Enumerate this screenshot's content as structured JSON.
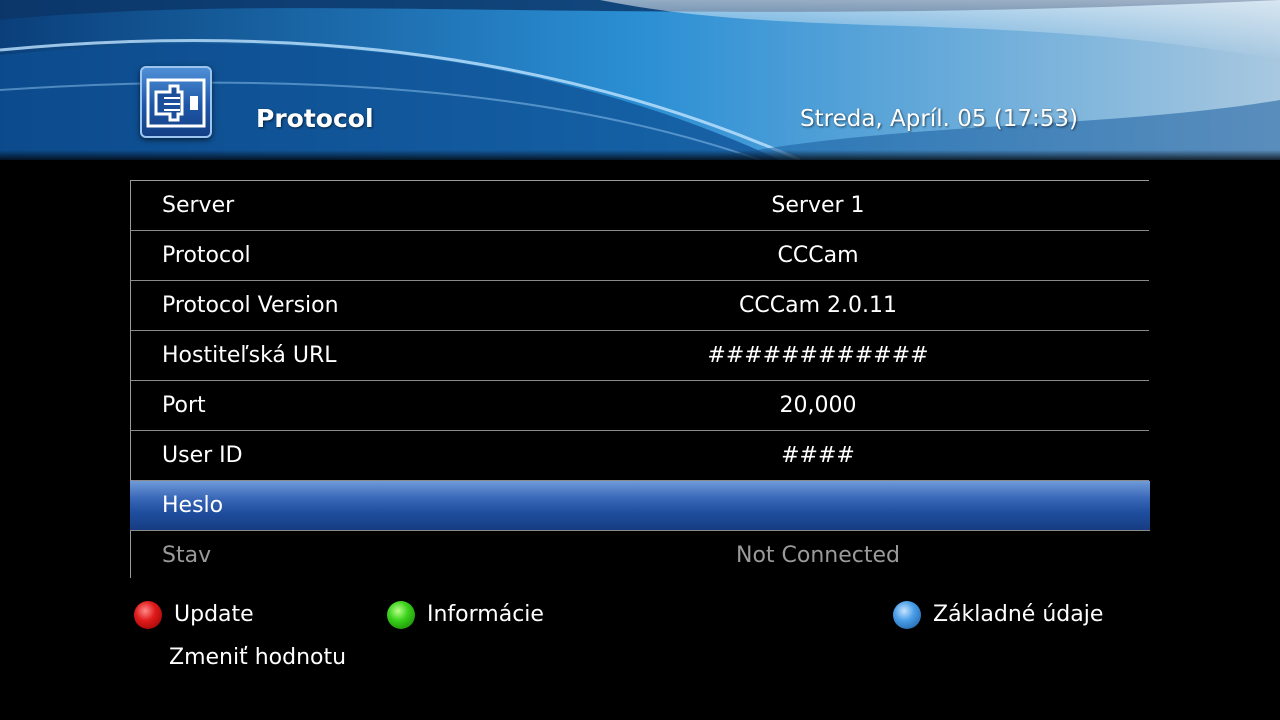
{
  "header": {
    "title": "Protocol",
    "date": "Streda, Apríl. 05 (17:53)",
    "icon": "network-card-icon"
  },
  "rows": [
    {
      "label": "Server",
      "value": "Server 1"
    },
    {
      "label": "Protocol",
      "value": "CCCam"
    },
    {
      "label": "Protocol Version",
      "value": "CCCam 2.0.11"
    },
    {
      "label": "Hostiteľská URL",
      "value": "############"
    },
    {
      "label": "Port",
      "value": "20,000"
    },
    {
      "label": "User ID",
      "value": "####"
    },
    {
      "label": "Heslo",
      "value": ""
    },
    {
      "label": "Stav",
      "value": "Not Connected"
    }
  ],
  "selected_row": "Heslo",
  "footer": {
    "red": {
      "label": "Update",
      "color": "#e01b1b"
    },
    "green": {
      "label": "Informácie",
      "color": "#39d11b"
    },
    "blue": {
      "label": "Základné údaje",
      "color": "#4a9ee8"
    },
    "hint": "Zmeniť hodnotu"
  }
}
